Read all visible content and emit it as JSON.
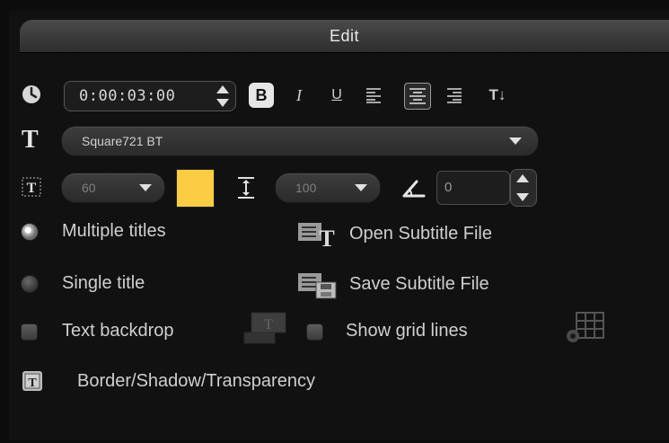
{
  "panel": {
    "title": "Edit"
  },
  "toolbar": {
    "time": "0:00:03:00",
    "bold": "B",
    "italic": "I",
    "underline": "U",
    "text_direction": "T↓"
  },
  "font": {
    "name": "Square721 BT"
  },
  "style_row": {
    "font_size": "60",
    "text_color": "#fccc45",
    "line_spacing": "100",
    "rotation": "0"
  },
  "options": {
    "multiple_titles": "Multiple titles",
    "single_title": "Single title",
    "open_subtitle": "Open Subtitle File",
    "save_subtitle": "Save Subtitle File",
    "text_backdrop": "Text backdrop",
    "show_grid": "Show grid lines",
    "border_shadow": "Border/Shadow/Transparency"
  },
  "state": {
    "selected_mode": "multiple_titles",
    "text_backdrop_checked": false,
    "show_grid_checked": false
  }
}
